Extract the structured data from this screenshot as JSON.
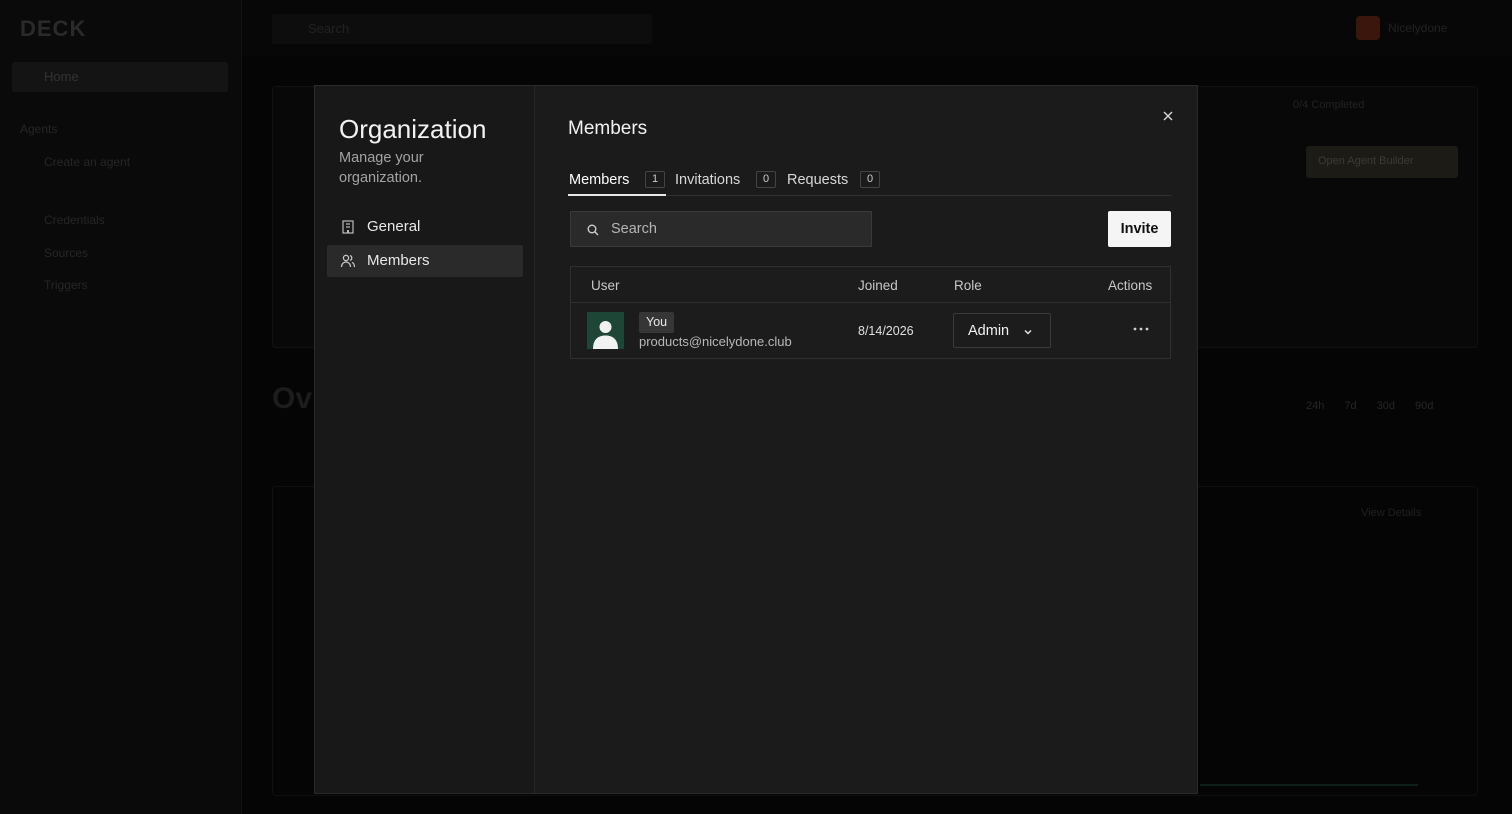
{
  "background": {
    "logo": "DECK",
    "home": "Home",
    "sidebar_section": "Agents",
    "create_agent": "Create an agent",
    "links": [
      "Credentials",
      "Sources",
      "Triggers"
    ],
    "search_placeholder": "Search",
    "user_name": "Nicelydone",
    "setup_status": "0/4 Completed",
    "cta": "Open Agent Builder",
    "overview_title": "Ov",
    "periods": [
      "24h",
      "7d",
      "30d",
      "90d"
    ],
    "view_details": "View Details"
  },
  "modal": {
    "sidebar": {
      "title": "Organization",
      "subtitle": "Manage your organization.",
      "items": [
        {
          "label": "General",
          "icon": "building-icon",
          "active": false
        },
        {
          "label": "Members",
          "icon": "users-icon",
          "active": true
        }
      ]
    },
    "main": {
      "title": "Members",
      "tabs": [
        {
          "label": "Members",
          "count": "1",
          "active": true
        },
        {
          "label": "Invitations",
          "count": "0",
          "active": false
        },
        {
          "label": "Requests",
          "count": "0",
          "active": false
        }
      ],
      "search_placeholder": "Search",
      "invite_label": "Invite",
      "table": {
        "headers": {
          "user": "User",
          "joined": "Joined",
          "role": "Role",
          "actions": "Actions"
        },
        "rows": [
          {
            "badge": "You",
            "email": "products@nicelydone.club",
            "joined": "8/14/2026",
            "role": "Admin"
          }
        ]
      }
    }
  },
  "colors": {
    "backdrop": "#050505",
    "modal_bg": "#1b1b1b",
    "avatar_bg": "#1e4636",
    "button_bg": "#f5f5f5"
  }
}
